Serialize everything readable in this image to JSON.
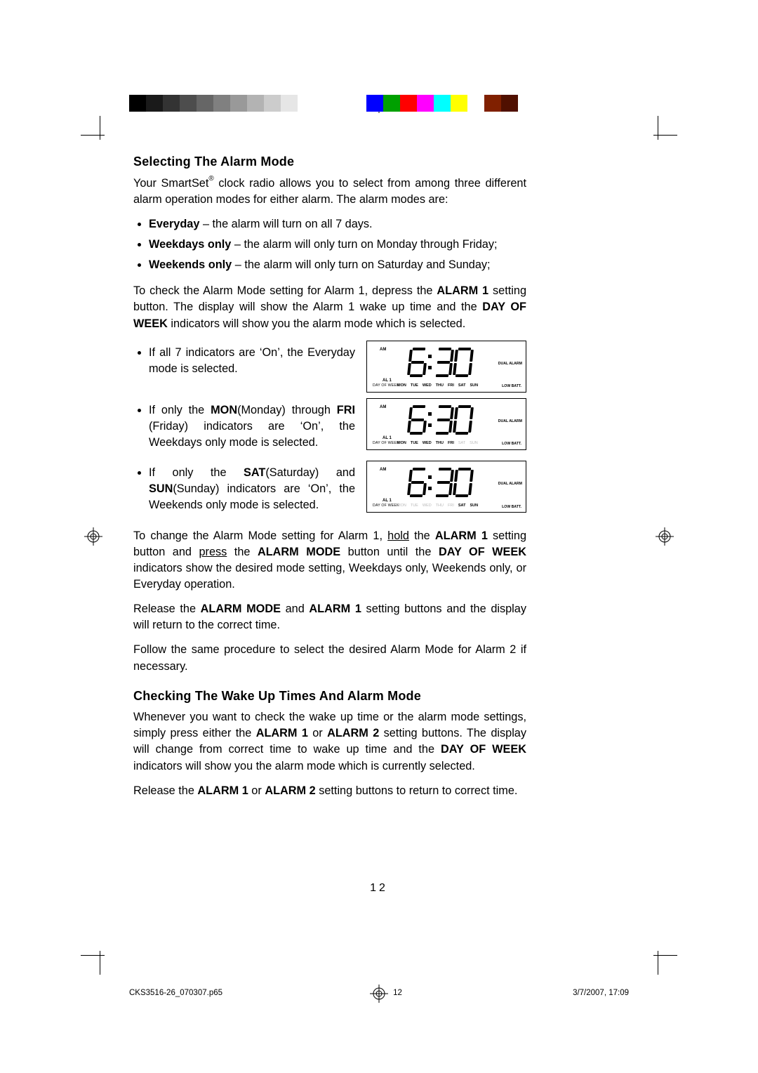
{
  "header": {
    "gray_swatches": [
      "#000000",
      "#1a1a1a",
      "#333333",
      "#4d4d4d",
      "#666666",
      "#808080",
      "#999999",
      "#b3b3b3",
      "#cccccc",
      "#e6e6e6",
      "#ffffff"
    ],
    "color_swatches": [
      "#0000ff",
      "#00a000",
      "#ff0000",
      "#ff00ff",
      "#00ffff",
      "#ffff00",
      "#ffffff",
      "#802000",
      "#501000"
    ]
  },
  "section1": {
    "heading": "Selecting The Alarm Mode",
    "intro_pre": "Your SmartSet",
    "intro_reg": "®",
    "intro_post": " clock radio allows you to select from among three different alarm operation modes for either alarm. The alarm modes are:",
    "mode1_b": "Everyday",
    "mode1_t": " – the alarm will turn on all 7 days.",
    "mode2_b": "Weekdays only",
    "mode2_t": " – the alarm will only turn on Monday through Friday;",
    "mode3_b": "Weekends only",
    "mode3_t": " – the alarm will only turn on Saturday and Sunday;",
    "check_a": "To check the Alarm Mode setting for Alarm 1, depress the ",
    "check_b1": "ALARM 1",
    "check_c": " setting button. The display will show the Alarm 1 wake up time and the ",
    "check_b2": "DAY OF WEEK",
    "check_d": " indicators will show you the alarm mode which is selected.",
    "bullet1": "If all 7 indicators are ‘On’, the Everyday mode is selected.",
    "bullet2_a": "If only the ",
    "bullet2_b1": "MON",
    "bullet2_c": "(Monday) through ",
    "bullet2_b2": "FRI",
    "bullet2_d": "(Friday) indicators are ‘On’, the Weekdays only mode is selected.",
    "bullet3_a": "If only the ",
    "bullet3_b1": "SAT",
    "bullet3_c": "(Saturday) and ",
    "bullet3_b2": "SUN",
    "bullet3_d": "(Sunday) indicators are ‘On’, the Weekends only mode is selected.",
    "change_a": "To change the Alarm Mode setting for Alarm 1, ",
    "change_u1": "hold",
    "change_b": " the ",
    "change_b1": "ALARM 1",
    "change_c": " setting button and ",
    "change_u2": "press",
    "change_d": " the ",
    "change_b2": "ALARM MODE",
    "change_e": " button until the ",
    "change_b3": "DAY OF WEEK",
    "change_f": " indicators show the desired mode setting, Weekdays only, Weekends only, or Everyday operation.",
    "release_a": "Release the ",
    "release_b1": "ALARM MODE",
    "release_b": " and ",
    "release_b2": "ALARM 1",
    "release_c": " setting buttons and the display will return to the correct time.",
    "follow": "Follow the same procedure to select the desired Alarm Mode for Alarm 2 if necessary."
  },
  "section2": {
    "heading": "Checking The Wake Up Times And Alarm Mode",
    "p1_a": "Whenever you want to check the wake up time or the alarm mode settings, simply press either the ",
    "p1_b1": "ALARM 1",
    "p1_b": " or ",
    "p1_b2": "ALARM 2",
    "p1_c": " setting buttons. The display will change from correct time to wake up time and the ",
    "p1_b3": "DAY OF WEEK",
    "p1_d": " indicators will show you the alarm mode which is currently selected.",
    "p2_a": "Release the ",
    "p2_b1": "ALARM 1",
    "p2_b": " or ",
    "p2_b2": "ALARM 2",
    "p2_c": " setting buttons to return to correct time."
  },
  "lcd": {
    "am": "AM",
    "al1": "AL 1",
    "dow_label": "DAY OF WEEK",
    "dual": "DUAL\nALARM",
    "low": "LOW BATT.",
    "days": [
      "MON",
      "TUE",
      "WED",
      "THU",
      "FRI",
      "SAT",
      "SUN"
    ],
    "time": "6:30",
    "modes": {
      "everyday": [
        true,
        true,
        true,
        true,
        true,
        true,
        true
      ],
      "weekdays": [
        true,
        true,
        true,
        true,
        true,
        false,
        false
      ],
      "weekends": [
        false,
        false,
        false,
        false,
        false,
        true,
        true
      ]
    }
  },
  "footer": {
    "page_number": "12",
    "filename": "CKS3516-26_070307.p65",
    "foot_page": "12",
    "timestamp": "3/7/2007, 17:09"
  }
}
